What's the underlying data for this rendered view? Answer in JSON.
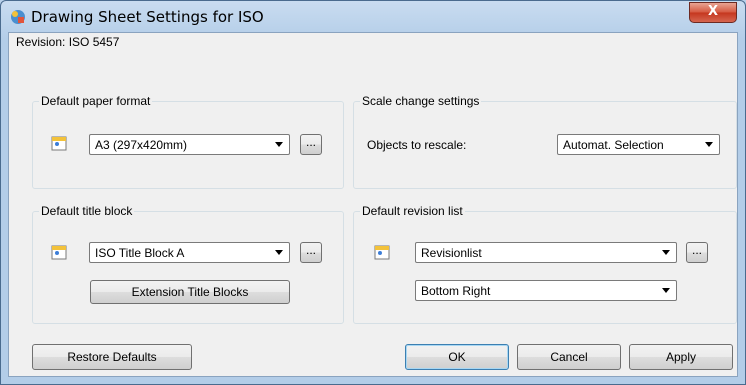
{
  "window": {
    "title": "Drawing Sheet Settings for ISO",
    "close_label": "X"
  },
  "revision": "Revision: ISO 5457",
  "paper": {
    "legend": "Default paper format",
    "value": "A3 (297x420mm)",
    "browse_label": "..."
  },
  "scale": {
    "legend": "Scale change settings",
    "objects_label": "Objects to rescale:",
    "value": "Automat. Selection"
  },
  "title_block": {
    "legend": "Default title block",
    "value": "ISO Title Block A",
    "browse_label": "...",
    "extension_label": "Extension Title Blocks"
  },
  "revision_list": {
    "legend": "Default revision list",
    "value": "Revisionlist",
    "browse_label": "...",
    "position_value": "Bottom Right"
  },
  "buttons": {
    "restore": "Restore Defaults",
    "ok": "OK",
    "cancel": "Cancel",
    "apply": "Apply"
  },
  "colors": {
    "accent": "#3c7fb1",
    "close": "#c4361e"
  }
}
